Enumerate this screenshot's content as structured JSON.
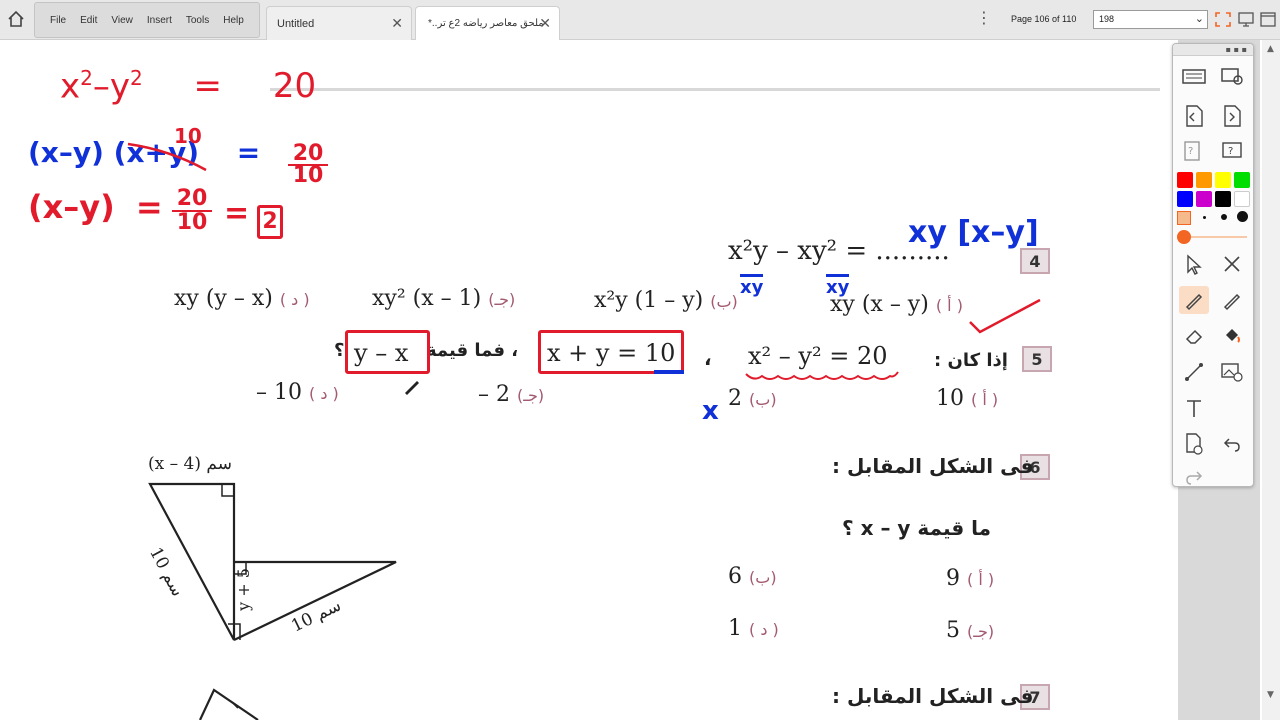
{
  "menu": [
    "File",
    "Edit",
    "View",
    "Insert",
    "Tools",
    "Help"
  ],
  "tabs": [
    {
      "title": "Untitled"
    },
    {
      "title": "*..ملحق معاصر رياضه 2ع تر"
    }
  ],
  "page_indicator": "Page 106 of 110",
  "zoom_value": "198",
  "colors": {
    "palette": [
      "#ff0000",
      "#ff9900",
      "#ffff00",
      "#00dd00",
      "#0000ff",
      "#cc00cc",
      "#000000",
      "#ffffff"
    ],
    "accent": "#f26522",
    "ink_red": "#e11b2b",
    "ink_blue": "#1030d8"
  },
  "handwriting": {
    "line1": {
      "lhs_x": "x",
      "lhs_x_exp": "2",
      "minus": "–",
      "lhs_y": "y",
      "lhs_y_exp": "2",
      "eq": "=",
      "rhs": "20"
    },
    "line2": {
      "factor1": "(x–y)",
      "factor2": "(x+y)",
      "over": "10",
      "eq": "=",
      "num": "20",
      "den": "10"
    },
    "line3": {
      "lhs": "(x–y)",
      "eq1": "=",
      "num": "20",
      "den": "10",
      "eq2": "=",
      "boxed": "2"
    },
    "q4_answer": "xy [x–y]",
    "q4_under1": "xy",
    "q4_under2": "xy",
    "q5_mark": "x"
  },
  "q4": {
    "number": "4",
    "question_lhs": "x²y – xy² = .........",
    "options": [
      {
        "letter": "( أ )",
        "value": "xy (x – y)"
      },
      {
        "letter": "(ب)",
        "value": "x²y (1 – y)"
      },
      {
        "letter": "(جـ)",
        "value": "xy² (x – 1)"
      },
      {
        "letter": "( د )",
        "value": "xy (y – x)"
      }
    ]
  },
  "q5": {
    "number": "5",
    "prefix": "إذا كان :",
    "eq1": "x² – y² = 20",
    "sep": "،",
    "eq2": "x + y = 10",
    "mid": "، فما قيمة",
    "asked": "y – x",
    "qmark": "؟",
    "options": [
      {
        "letter": "( أ )",
        "value": "10"
      },
      {
        "letter": "(ب)",
        "value": "2"
      },
      {
        "letter": "(جـ)",
        "value": "– 2"
      },
      {
        "letter": "( د )",
        "value": "– 10"
      }
    ]
  },
  "q6": {
    "number": "6",
    "text": "فى الشكل المقابل :",
    "question": "ما قيمة x – y ؟",
    "figure": {
      "top_label": "(x – 4) سم",
      "left_label": "10 سم",
      "mid_label": "y + 5",
      "bottom_label": "10 سم"
    },
    "options": [
      {
        "letter": "( أ )",
        "value": "9"
      },
      {
        "letter": "(ب)",
        "value": "6"
      },
      {
        "letter": "(جـ)",
        "value": "5"
      },
      {
        "letter": "( د )",
        "value": "1"
      }
    ]
  },
  "q7": {
    "number": "7",
    "text": "فى الشكل المقابل :"
  }
}
